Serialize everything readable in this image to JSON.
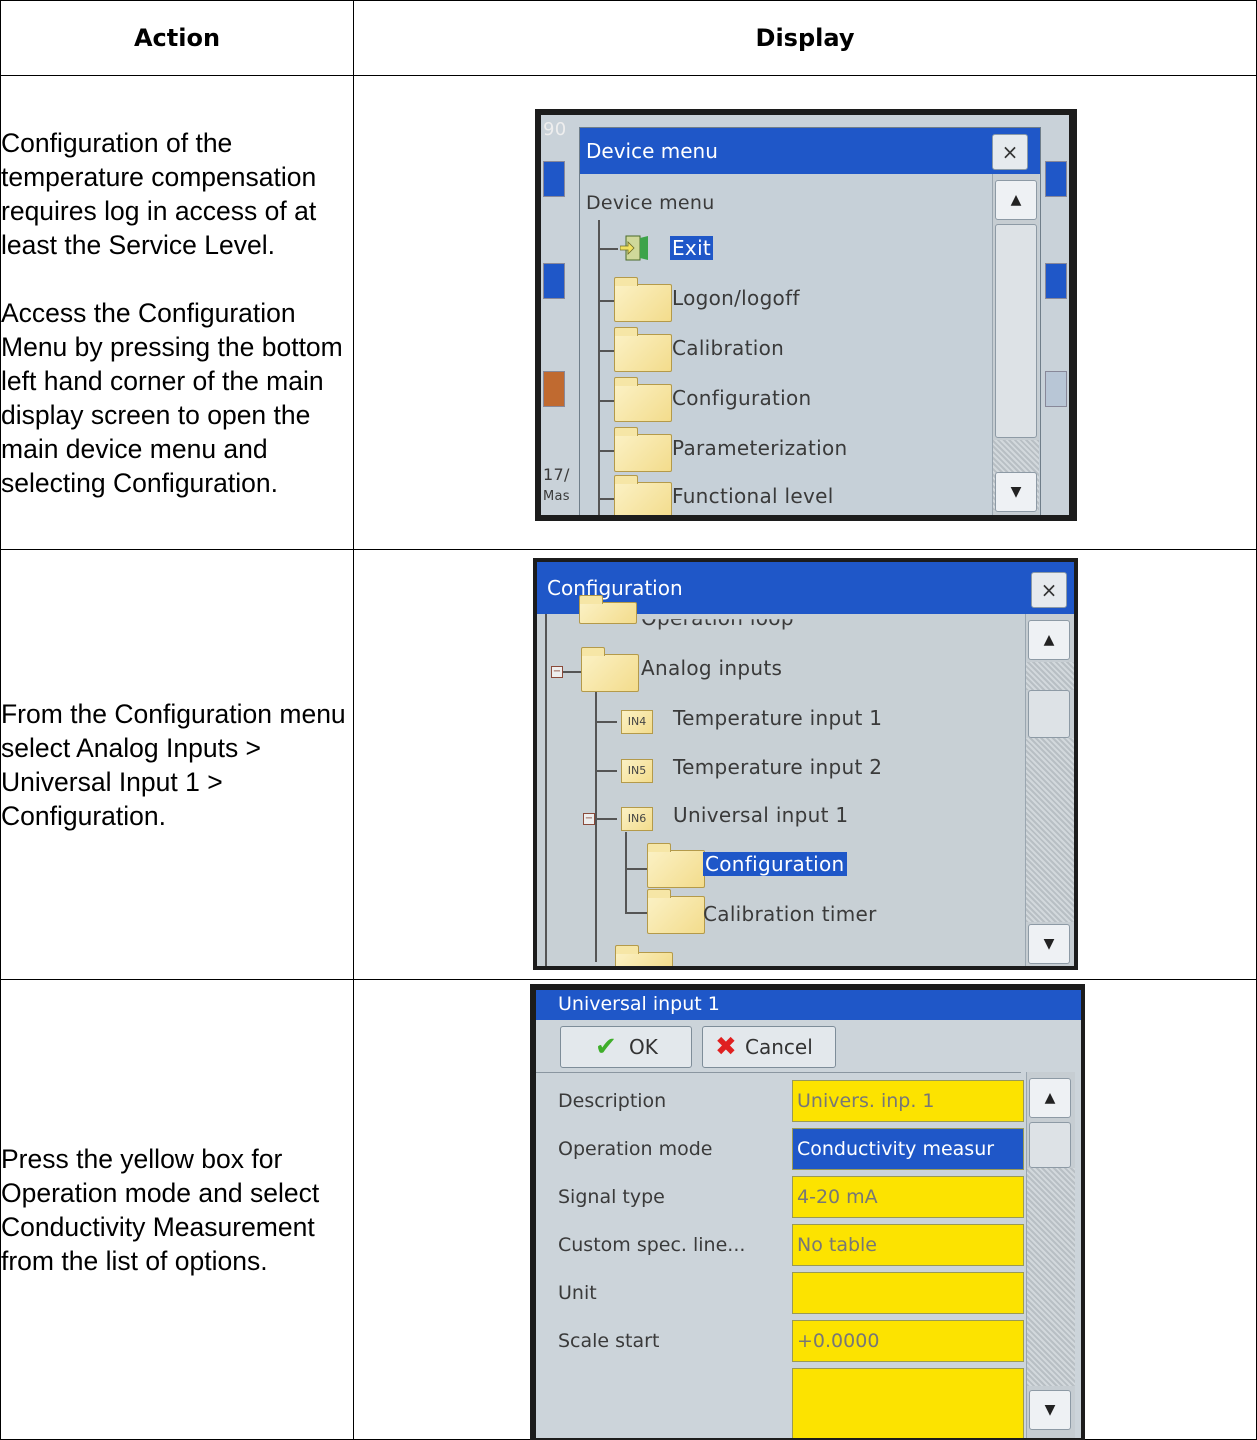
{
  "table": {
    "header_action": "Action",
    "header_display": "Display"
  },
  "rows": [
    {
      "action_p1": "Configuration of the temperature compensation requires log in access of at least the Service Level.",
      "action_p2": "Access the Configuration Menu by pressing the bottom left hand corner of the main display screen to open the main device menu and selecting Configuration."
    },
    {
      "action_p1": "From the Configuration menu select Analog Inputs > Universal Input 1 > Configuration."
    },
    {
      "action_p1": "Press the yellow box for Operation mode and select Conductivity Measurement from the list of options."
    }
  ],
  "screen1": {
    "bg_fragment_top": "90",
    "bg_fragment_bottom1": "17/",
    "bg_fragment_bottom2": "Mas",
    "dialog_title": "Device menu",
    "close_glyph": "×",
    "tree_root": "Device menu",
    "items": [
      "Exit",
      "Logon/logoff",
      "Calibration",
      "Configuration",
      "Parameterization",
      "Functional level"
    ],
    "exit_icon": "exit-door-icon",
    "scroll_up": "▲",
    "scroll_down": "▼"
  },
  "screen2": {
    "dialog_title": "Configuration",
    "close_glyph": "×",
    "items": [
      "Operation loop",
      "Analog inputs",
      "Temperature input 1",
      "Temperature input 2",
      "Universal input 1",
      "Configuration",
      "Calibration timer"
    ],
    "tags": [
      "IN4",
      "IN5",
      "IN6"
    ],
    "scroll_up": "▲",
    "scroll_down": "▼"
  },
  "screen3": {
    "dialog_title": "Universal input 1",
    "ok_label": "OK",
    "cancel_label": "Cancel",
    "fields": [
      {
        "label": "Description",
        "value": "Univers. inp. 1"
      },
      {
        "label": "Operation mode",
        "value": "Conductivity measur"
      },
      {
        "label": "Signal type",
        "value": "4-20 mA"
      },
      {
        "label": "Custom spec. line...",
        "value": "No table"
      },
      {
        "label": "Unit",
        "value": ""
      },
      {
        "label": "Scale start",
        "value": "+0.0000"
      }
    ],
    "scroll_up": "▲",
    "scroll_down": "▼",
    "accent": "#1f57c8",
    "field_color": "#fce300"
  }
}
